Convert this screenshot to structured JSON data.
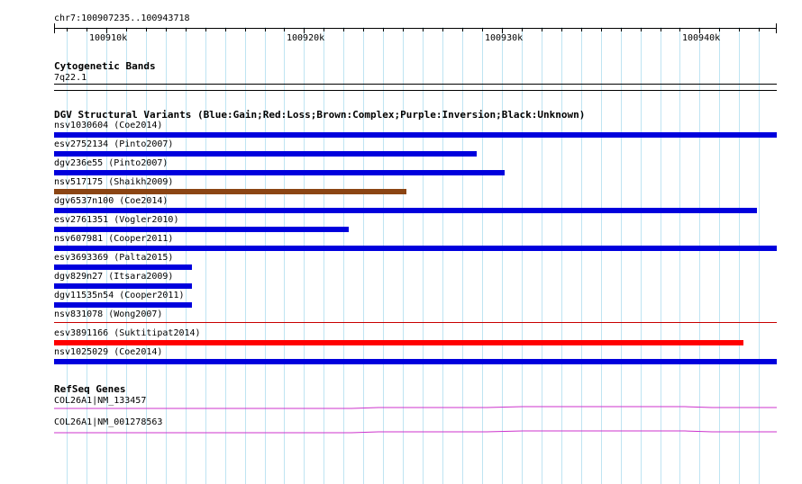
{
  "ruler": {
    "location": "chr7:100907235..100943718",
    "labels": [
      "100910k",
      "100920k",
      "100930k",
      "100940k"
    ]
  },
  "cytoband": {
    "title": "Cytogenetic Bands",
    "band": "7q22.1"
  },
  "dgv": {
    "title": "DGV Structural Variants (Blue:Gain;Red:Loss;Brown:Complex;Purple:Inversion;Black:Unknown)",
    "features": [
      {
        "label": "nsv1030604 (Coe2014)",
        "color": "#0000dd"
      },
      {
        "label": "esv2752134 (Pinto2007)",
        "color": "#0000dd"
      },
      {
        "label": "dgv236e55 (Pinto2007)",
        "color": "#0000dd"
      },
      {
        "label": "nsv517175 (Shaikh2009)",
        "color": "#8b4513"
      },
      {
        "label": "dgv6537n100 (Coe2014)",
        "color": "#0000dd"
      },
      {
        "label": "esv2761351 (Vogler2010)",
        "color": "#0000dd"
      },
      {
        "label": "nsv607981 (Cooper2011)",
        "color": "#0000dd"
      },
      {
        "label": "esv3693369 (Palta2015)",
        "color": "#0000dd"
      },
      {
        "label": "dgv829n27 (Itsara2009)",
        "color": "#0000dd"
      },
      {
        "label": "dgv11535n54 (Cooper2011)",
        "color": "#0000dd"
      },
      {
        "label": "nsv831078 (Wong2007)",
        "color": "#c80000"
      },
      {
        "label": "esv3891166 (Suktitipat2014)",
        "color": "#ff0000"
      },
      {
        "label": "nsv1025029 (Coe2014)",
        "color": "#0000dd"
      }
    ]
  },
  "refseq": {
    "title": "RefSeq Genes",
    "genes": [
      {
        "label": "COL26A1|NM_133457",
        "color": "#cc33cc"
      },
      {
        "label": "COL26A1|NM_001278563",
        "color": "#cc33cc"
      }
    ]
  }
}
